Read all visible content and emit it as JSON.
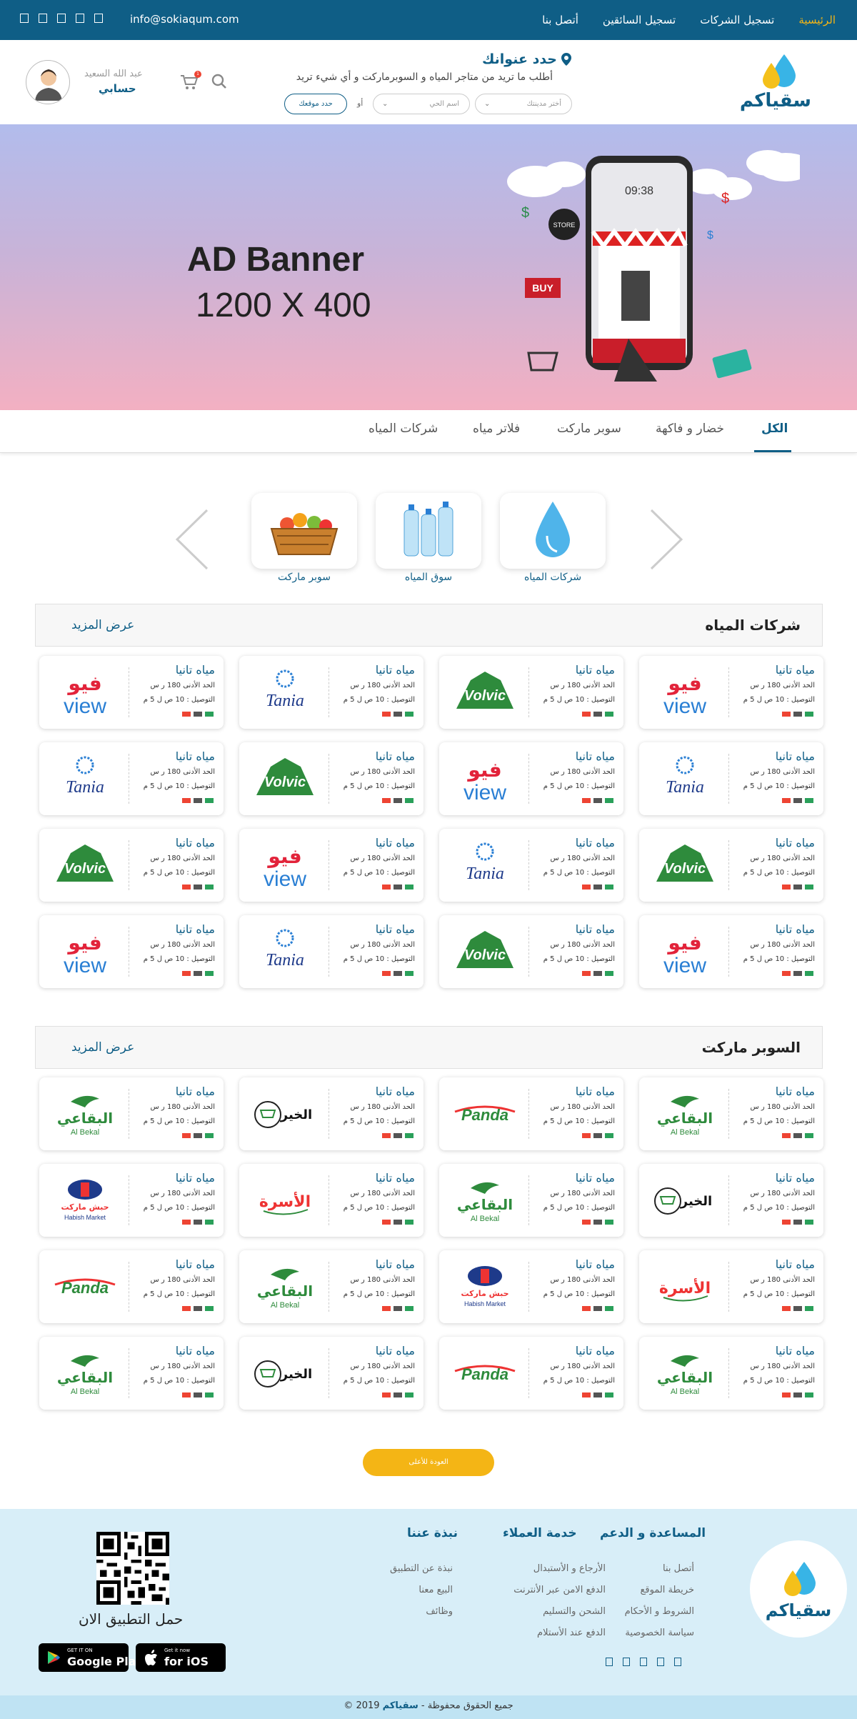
{
  "topbar": {
    "nav": [
      "الرئيسية",
      "تسجيل الشركات",
      "تسجيل السائقين",
      "أتصل بنا"
    ],
    "email": "info@sokiaqum.com"
  },
  "header": {
    "address_title": "حدد عنوانك",
    "address_sub": "أطلب ما تريد من متاجر المياه و السوبرماركت و أي شيء تريد",
    "city_placeholder": "أختر مدينتك",
    "district_placeholder": "اسم الحي",
    "or": "أو",
    "locate_btn": "حدد موقعك",
    "user_name": "عبد الله السعيد",
    "account": "حسابي",
    "cart_count": "1"
  },
  "banner": {
    "line1": "AD Banner",
    "line2": "1200 X 400"
  },
  "tabs": [
    "الكل",
    "خضار و فاكهة",
    "سوبر ماركت",
    "فلاتر مياه",
    "شركات المياه"
  ],
  "categories": [
    {
      "label": "شركات المياه",
      "icon": "water-drop-icon"
    },
    {
      "label": "سوق المياه",
      "icon": "water-bottles-icon"
    },
    {
      "label": "سوبر ماركت",
      "icon": "grocery-basket-icon"
    }
  ],
  "sections": [
    {
      "title": "شركات المياه",
      "more": "عرض المزيد"
    },
    {
      "title": "السوبر ماركت",
      "more": "عرض المزيد"
    }
  ],
  "card": {
    "title": "مياه تانيا",
    "min_order": "الحد الأدنى 180 ر س",
    "delivery": "التوصيل : 10 ص ل 5 م"
  },
  "water_brands": [
    [
      "view",
      "volvic",
      "tania",
      "view"
    ],
    [
      "tania",
      "view",
      "volvic",
      "tania"
    ],
    [
      "volvic",
      "tania",
      "view",
      "volvic"
    ],
    [
      "view",
      "volvic",
      "tania",
      "view"
    ]
  ],
  "market_brands": [
    [
      "bekal",
      "panda",
      "khair",
      "bekal"
    ],
    [
      "khair",
      "bekal",
      "osra",
      "habish"
    ],
    [
      "osra",
      "habish",
      "bekal",
      "panda"
    ],
    [
      "bekal",
      "panda",
      "khair",
      "bekal"
    ]
  ],
  "brand_text": {
    "view": "فيو",
    "volvic": "Volvic",
    "tania": "Tania",
    "bekal": "البقاعي",
    "panda": "Panda",
    "khair": "الخير",
    "osra": "الأسرة",
    "habish": "حبش ماركت"
  },
  "back_to_top": "العودة للأعلى",
  "footer": {
    "logo_text": "سقياكم",
    "cols": [
      {
        "title": "المساعدة و الدعم",
        "links": [
          "أتصل بنا",
          "خريطة الموقع",
          "الشروط و الأحكام",
          "سياسة الخصوصية"
        ]
      },
      {
        "title": "خدمة العملاء",
        "links": [
          "الأرجاع و الأستبدال",
          "الدفع الامن عبر الأنترنت",
          "الشحن والتسليم",
          "الدفع عند الأستلام"
        ]
      },
      {
        "title": "نبذة عننا",
        "links": [
          "نبذة عن التطبيق",
          "البيع معنا",
          "وظائف"
        ]
      }
    ],
    "download": "حمل التطبيق الان",
    "google_small": "GET IT ON",
    "google_big": "Google Play",
    "apple_small": "Get it now",
    "apple_big": "for iOS"
  },
  "copyright_pre": "© جميع الحقوق محفوظة - ",
  "copyright_brand": "سقياكم",
  "copyright_year": " 2019",
  "colors": {
    "primary": "#0f5e86",
    "accent": "#f4b515",
    "footer": "#d8eef8"
  }
}
